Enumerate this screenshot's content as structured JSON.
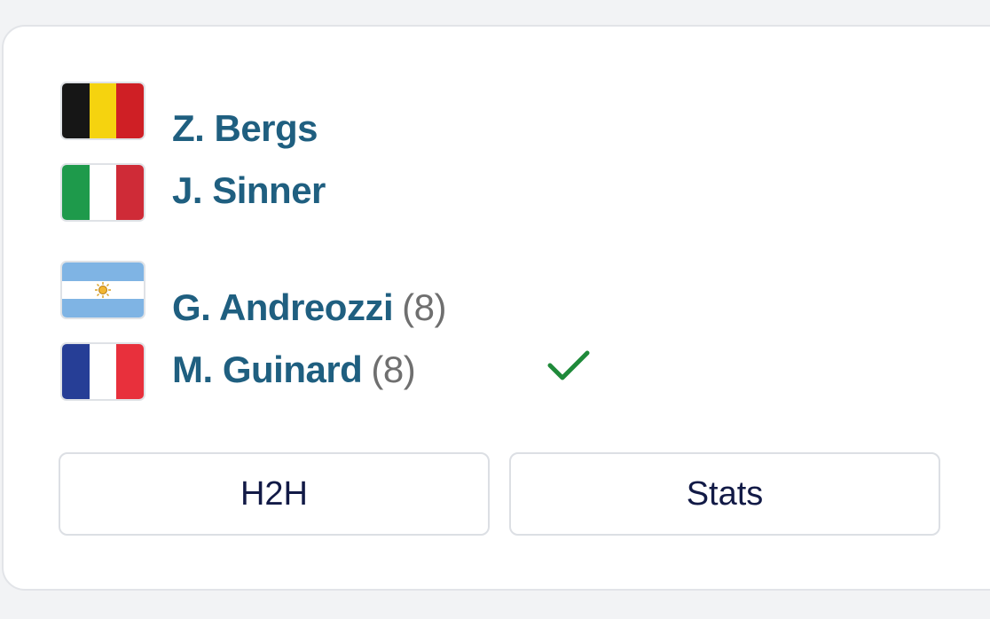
{
  "match": {
    "team1": {
      "players": [
        {
          "name": "Z. Bergs",
          "seed": "",
          "country_flag": "belgium-flag",
          "flag_colors": [
            "#161616",
            "#f5d30f",
            "#cf1f25"
          ]
        },
        {
          "name": "J. Sinner",
          "seed": "",
          "country_flag": "italy-flag",
          "flag_colors": [
            "#1e9a4b",
            "#ffffff",
            "#cf2b37"
          ]
        }
      ]
    },
    "team2": {
      "players": [
        {
          "name": "G. Andreozzi",
          "seed": "(8)",
          "country_flag": "argentina-flag",
          "flag_colors": [
            "#7fb4e4",
            "#ffffff",
            "#7fb4e4"
          ]
        },
        {
          "name": "M. Guinard",
          "seed": "(8)",
          "country_flag": "france-flag",
          "flag_colors": [
            "#263e96",
            "#ffffff",
            "#e8303c"
          ]
        }
      ],
      "winner": true,
      "winner_icon": "checkmark-icon",
      "winner_color": "#1f8a3a"
    }
  },
  "buttons": {
    "h2h_label": "H2H",
    "stats_label": "Stats"
  },
  "colors": {
    "player_name": "#1f5f80",
    "seed": "#6f6f6f",
    "button_text": "#121a46"
  }
}
